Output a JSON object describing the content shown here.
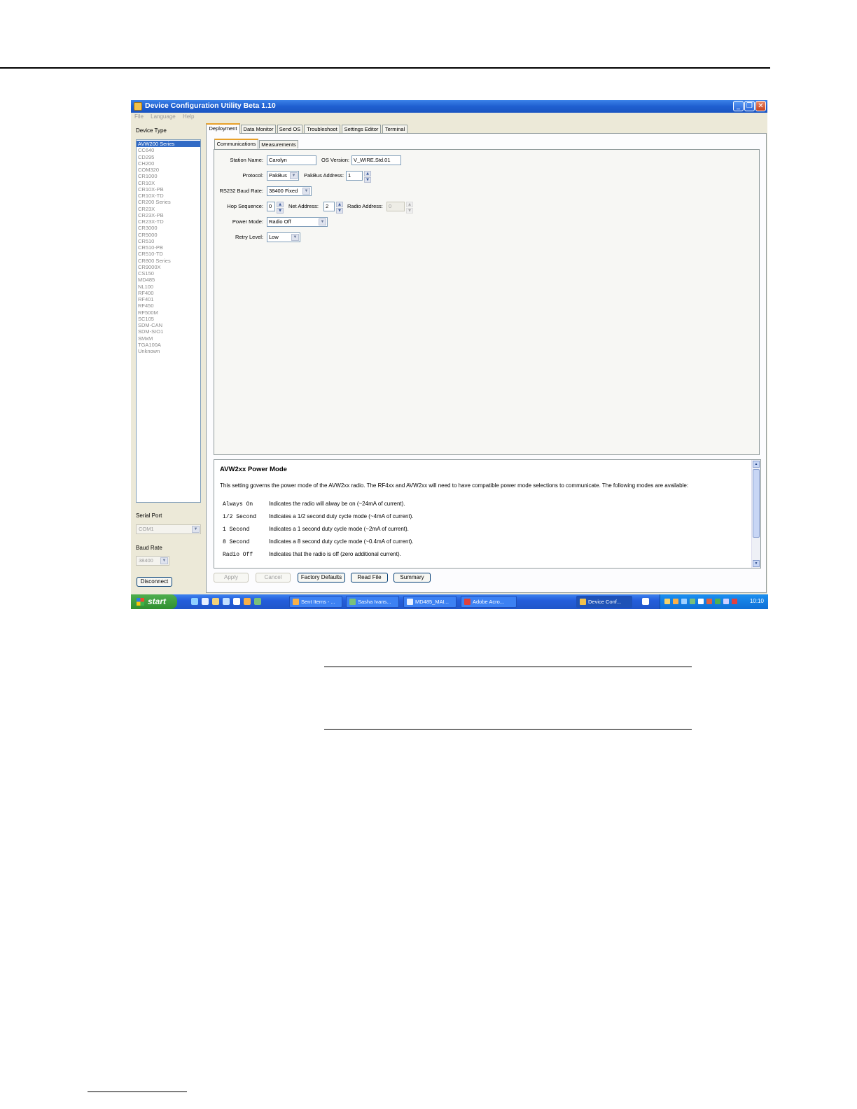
{
  "window": {
    "title": "Device Configuration Utility Beta 1.10",
    "menu": [
      "File",
      "Language",
      "Help"
    ]
  },
  "sidebar": {
    "device_type_label": "Device Type",
    "devices": [
      "AVW200 Series",
      "CC640",
      "CD295",
      "CH200",
      "COM320",
      "CR1000",
      "CR10X",
      "CR10X-PB",
      "CR10X-TD",
      "CR200 Series",
      "CR23X",
      "CR23X-PB",
      "CR23X-TD",
      "CR3000",
      "CR5000",
      "CR510",
      "CR510-PB",
      "CR510-TD",
      "CR800 Series",
      "CR9000X",
      "CS150",
      "MD485",
      "NL100",
      "RF400",
      "RF401",
      "RF450",
      "RF500M",
      "SC105",
      "SDM-CAN",
      "SDM-SIO1",
      "SMxM",
      "TGA100A",
      "Unknown"
    ],
    "selected_index": 0,
    "serial_port_label": "Serial Port",
    "serial_port_value": "COM1",
    "baud_rate_label": "Baud Rate",
    "baud_rate_value": "38400",
    "disconnect_label": "Disconnect"
  },
  "tabs": [
    "Deployment",
    "Data Monitor",
    "Send OS",
    "Troubleshoot",
    "Settings Editor",
    "Terminal"
  ],
  "sub_tabs": [
    "Communications",
    "Measurements"
  ],
  "form": {
    "station_name_label": "Station Name:",
    "station_name_value": "Carolyn",
    "os_version_label": "OS Version:",
    "os_version_value": "V_WIRE.Std.01",
    "protocol_label": "Protocol:",
    "protocol_value": "PakBus",
    "pakbus_address_label": "PakBus Address:",
    "pakbus_address_value": "1",
    "rs232_label": "RS232 Baud Rate:",
    "rs232_value": "38400 Fixed",
    "hop_label": "Hop Sequence:",
    "hop_value": "0",
    "net_address_label": "Net Address:",
    "net_address_value": "2",
    "radio_address_label": "Radio Address:",
    "radio_address_value": "0",
    "power_mode_label": "Power Mode:",
    "power_mode_value": "Radio Off",
    "retry_label": "Retry Level:",
    "retry_value": "Low"
  },
  "help": {
    "title": "AVW2xx Power Mode",
    "description": "This setting governs the power mode of the AVW2xx radio. The RF4xx and AVW2xx will need to have compatible power mode selections to communicate. The following modes are available:",
    "modes": [
      {
        "code": "Always On",
        "text": "Indicates the radio will alway be on (~24mA of current)."
      },
      {
        "code": "1/2 Second",
        "text": "Indicates a 1/2 second duty cycle mode (~4mA of current)."
      },
      {
        "code": "1 Second",
        "text": "Indicates a 1 second duty cycle mode (~2mA of current)."
      },
      {
        "code": "8 Second",
        "text": "Indicates a 8 second duty cycle mode (~0.4mA of current)."
      },
      {
        "code": "Radio Off",
        "text": "Indicates that the radio is off (zero additional current)."
      }
    ]
  },
  "buttons": {
    "apply": "Apply",
    "cancel": "Cancel",
    "factory_defaults": "Factory Defaults",
    "read_file": "Read File",
    "summary": "Summary"
  },
  "taskbar": {
    "start_label": "start",
    "tasks": [
      "Sent Items - ...",
      "Sasha Ivans...",
      "MD485_MAI...",
      "Adobe Acro...",
      "Device Conf..."
    ],
    "clock": "10:10"
  }
}
